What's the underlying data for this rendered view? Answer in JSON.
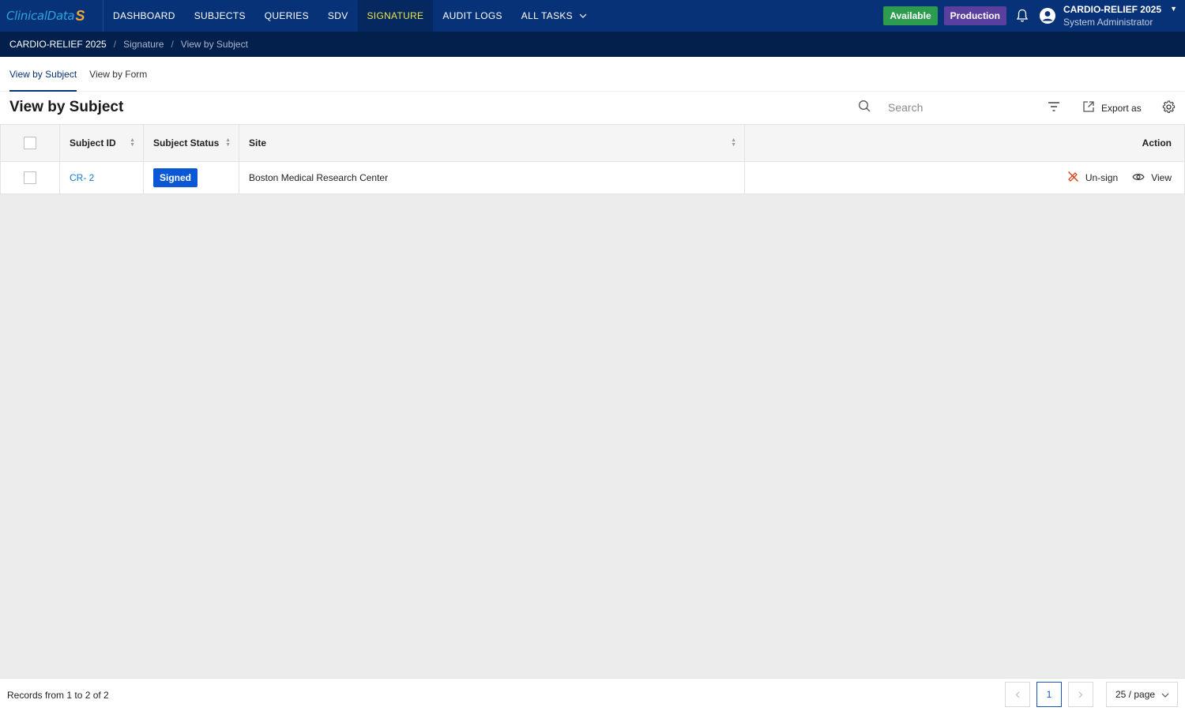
{
  "topnav": {
    "logo_main": "ClinicalData",
    "logo_mark": "S",
    "items": [
      {
        "label": "DASHBOARD"
      },
      {
        "label": "SUBJECTS"
      },
      {
        "label": "QUERIES"
      },
      {
        "label": "SDV"
      },
      {
        "label": "SIGNATURE"
      },
      {
        "label": "AUDIT LOGS"
      },
      {
        "label": "ALL TASKS"
      }
    ],
    "active_item": "SIGNATURE",
    "status_badge": "Available",
    "env_badge": "Production",
    "user_study": "CARDIO-RELIEF 2025",
    "user_role": "System Administrator",
    "icons": [
      "bell-icon",
      "user-avatar-icon",
      "caret-down-icon"
    ],
    "colors": {
      "nav_bg": "#073277",
      "active_text": "#e8e64a",
      "available": "#2d9c4e",
      "production": "#5a3f9e"
    }
  },
  "breadcrumb": {
    "study": "CARDIO-RELIEF 2025",
    "items": [
      "Signature",
      "View by Subject"
    ]
  },
  "tabs": [
    "View by Subject",
    "View by Form"
  ],
  "active_tab": "View by Subject",
  "page_title": "View by Subject",
  "toolbar": {
    "search_placeholder": "Search",
    "export_label": "Export as",
    "icons": [
      "search-icon",
      "filter-icon",
      "export-icon",
      "settings-icon"
    ]
  },
  "table": {
    "columns": [
      "Subject ID",
      "Subject Status",
      "Site",
      "Action"
    ],
    "rows": [
      {
        "subject_id": "CR- 2",
        "status": "Signed",
        "site": "Boston Medical Research Center",
        "actions": [
          "Un-sign",
          "View"
        ]
      }
    ],
    "status_color": "#0a58d6"
  },
  "footer": {
    "records_text": "Records from 1 to 2 of 2",
    "current_page": "1",
    "page_size": "25 / page"
  }
}
